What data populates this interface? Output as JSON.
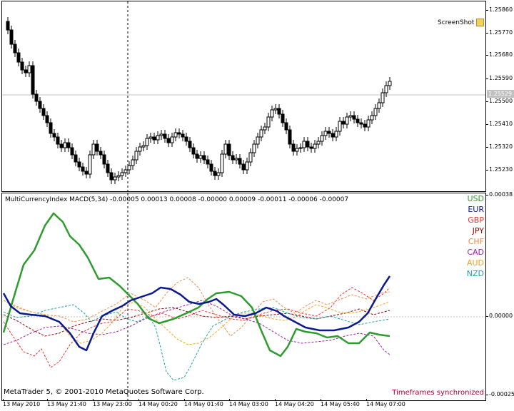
{
  "main_chart": {
    "screenshot_label": "ScreenShot",
    "price_axis": [
      "1.25860",
      "1.25770",
      "1.25680",
      "1.25590",
      "1.25500",
      "1.25410",
      "1.25320",
      "1.25230"
    ],
    "current_price": "1.25529",
    "icons": [
      "screenshot-icon"
    ]
  },
  "indicator": {
    "title": "MultiCurrencyIndex MACD(5,34) -0.00005 0.00013 0.00008 -0.00000 0.00009 -0.00011 -0.00006 -0.00007",
    "axis": {
      "top": "0.00038",
      "zero": "0.00000",
      "bottom": "-0.00025"
    },
    "copyright": "MetaTrader 5, © 2001-2010 MetaQuotes Software Corp.",
    "status": "Timeframes synchronized",
    "legend": [
      {
        "name": "USD",
        "color": "#2e9b2e"
      },
      {
        "name": "EUR",
        "color": "#0a1a8c"
      },
      {
        "name": "GBP",
        "color": "#e8332a"
      },
      {
        "name": "JPY",
        "color": "#8b0000"
      },
      {
        "name": "CHF",
        "color": "#f08a4b"
      },
      {
        "name": "CAD",
        "color": "#9b1ea6"
      },
      {
        "name": "AUD",
        "color": "#f4a11a"
      },
      {
        "name": "NZD",
        "color": "#1aa0a8"
      }
    ]
  },
  "time_axis": [
    "13 May 2010",
    "13 May 21:40",
    "13 May 23:00",
    "14 May 00:20",
    "14 May 01:40",
    "14 May 03:00",
    "14 May 04:20",
    "14 May 05:40",
    "14 May 07:00"
  ]
}
